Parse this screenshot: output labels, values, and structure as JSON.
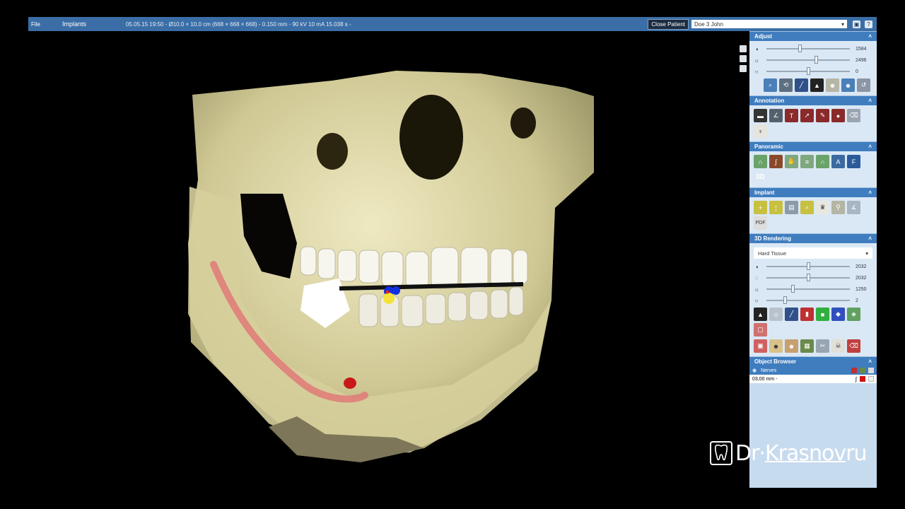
{
  "topbar": {
    "file_label": "File",
    "tool_label": "Implants",
    "info": "05.05.15 19:50 - Ø10.0 × 10.0 cm (668 × 668 × 668) - 0.150 mm - 90 kV 10 mA 15.038 s -",
    "close_patient": "Close Patient",
    "patient": "Doe 3 John"
  },
  "adjust": {
    "title": "Adjust",
    "sliders": [
      {
        "icon": "contrast-icon",
        "value": "1584",
        "level": 0.38
      },
      {
        "icon": "brightness-icon",
        "value": "2496",
        "level": 0.58
      },
      {
        "icon": "gamma-icon",
        "value": "0",
        "level": 0.48
      }
    ],
    "tools": [
      "zoom-icon",
      "rotate-icon",
      "window-level-icon",
      "histogram-icon",
      "skull-icon",
      "skull-selected-icon",
      "reset-icon"
    ]
  },
  "annotation": {
    "title": "Annotation",
    "tools": [
      "ruler-icon",
      "angle-icon",
      "text-icon",
      "arrow-icon",
      "freehand-icon",
      "marker-icon",
      "eraser-icon",
      "tooth-icon"
    ]
  },
  "panoramic": {
    "title": "Panoramic",
    "tools": [
      "curve-icon",
      "nerve-icon",
      "hand-icon",
      "slices-icon",
      "draw-curve-icon",
      "curve-a-icon",
      "curve-f-icon"
    ],
    "label_3d": "3D"
  },
  "implant": {
    "title": "Implant",
    "tools": [
      "implant-add-icon",
      "implant-icon",
      "implant-library-icon",
      "implant-search-icon",
      "crown-icon",
      "abutment-icon",
      "implant-angle-icon",
      "pdf-icon"
    ]
  },
  "rendering": {
    "title": "3D Rendering",
    "preset": "Hard Tissue",
    "sliders": [
      {
        "icon": "contrast-icon",
        "value": "2032",
        "level": 0.48
      },
      {
        "icon": "opacity-icon",
        "value": "2032",
        "level": 0.48
      },
      {
        "icon": "brightness-icon",
        "value": "1250",
        "level": 0.3
      },
      {
        "icon": "gamma-icon",
        "value": "2",
        "level": 0.2
      }
    ],
    "tools_row1": [
      "volume-icon",
      "person-icon",
      "clip-icon",
      "red-plane-icon",
      "green-plane-icon",
      "blue-plane-icon",
      "cube-color-icon",
      "frame-icon"
    ],
    "tools_row2": [
      "box-icon",
      "head-icon",
      "head-soft-icon",
      "color-map-icon",
      "cut-icon",
      "skull-small-icon",
      "eraser-3d-icon"
    ]
  },
  "object_browser": {
    "title": "Object Browser",
    "group": "Nerves",
    "item": "03,00 mm -"
  },
  "logo": {
    "text1": "Dr·",
    "text2": "Krasnov",
    "text3": "ru"
  },
  "colors": {
    "accent": "#3f7dbf",
    "bone": "#d9d4a6",
    "nerve": "#e07a78"
  }
}
